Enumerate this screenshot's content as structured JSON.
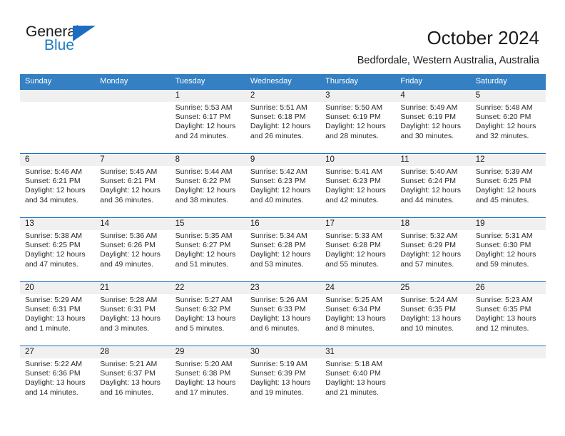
{
  "brand": {
    "word_one": "General",
    "word_two": "Blue",
    "triangle_color": "#1b6ec2",
    "blue_color": "#1f7bc1"
  },
  "header": {
    "title": "October 2024",
    "subtitle": "Bedfordale, Western Australia, Australia"
  },
  "theme": {
    "header_blue": "#3580c3",
    "row_divider_blue": "#1b6ec2",
    "day_band_gray": "#f0f0f0"
  },
  "weekdays": [
    "Sunday",
    "Monday",
    "Tuesday",
    "Wednesday",
    "Thursday",
    "Friday",
    "Saturday"
  ],
  "labels": {
    "sunrise": "Sunrise:",
    "sunset": "Sunset:",
    "daylight": "Daylight:"
  },
  "weeks": [
    [
      {
        "day": "",
        "sunrise": "",
        "sunset": "",
        "daylight_line1": "",
        "daylight_line2": ""
      },
      {
        "day": "",
        "sunrise": "",
        "sunset": "",
        "daylight_line1": "",
        "daylight_line2": ""
      },
      {
        "day": "1",
        "sunrise": "Sunrise: 5:53 AM",
        "sunset": "Sunset: 6:17 PM",
        "daylight_line1": "Daylight: 12 hours",
        "daylight_line2": "and 24 minutes."
      },
      {
        "day": "2",
        "sunrise": "Sunrise: 5:51 AM",
        "sunset": "Sunset: 6:18 PM",
        "daylight_line1": "Daylight: 12 hours",
        "daylight_line2": "and 26 minutes."
      },
      {
        "day": "3",
        "sunrise": "Sunrise: 5:50 AM",
        "sunset": "Sunset: 6:19 PM",
        "daylight_line1": "Daylight: 12 hours",
        "daylight_line2": "and 28 minutes."
      },
      {
        "day": "4",
        "sunrise": "Sunrise: 5:49 AM",
        "sunset": "Sunset: 6:19 PM",
        "daylight_line1": "Daylight: 12 hours",
        "daylight_line2": "and 30 minutes."
      },
      {
        "day": "5",
        "sunrise": "Sunrise: 5:48 AM",
        "sunset": "Sunset: 6:20 PM",
        "daylight_line1": "Daylight: 12 hours",
        "daylight_line2": "and 32 minutes."
      }
    ],
    [
      {
        "day": "6",
        "sunrise": "Sunrise: 5:46 AM",
        "sunset": "Sunset: 6:21 PM",
        "daylight_line1": "Daylight: 12 hours",
        "daylight_line2": "and 34 minutes."
      },
      {
        "day": "7",
        "sunrise": "Sunrise: 5:45 AM",
        "sunset": "Sunset: 6:21 PM",
        "daylight_line1": "Daylight: 12 hours",
        "daylight_line2": "and 36 minutes."
      },
      {
        "day": "8",
        "sunrise": "Sunrise: 5:44 AM",
        "sunset": "Sunset: 6:22 PM",
        "daylight_line1": "Daylight: 12 hours",
        "daylight_line2": "and 38 minutes."
      },
      {
        "day": "9",
        "sunrise": "Sunrise: 5:42 AM",
        "sunset": "Sunset: 6:23 PM",
        "daylight_line1": "Daylight: 12 hours",
        "daylight_line2": "and 40 minutes."
      },
      {
        "day": "10",
        "sunrise": "Sunrise: 5:41 AM",
        "sunset": "Sunset: 6:23 PM",
        "daylight_line1": "Daylight: 12 hours",
        "daylight_line2": "and 42 minutes."
      },
      {
        "day": "11",
        "sunrise": "Sunrise: 5:40 AM",
        "sunset": "Sunset: 6:24 PM",
        "daylight_line1": "Daylight: 12 hours",
        "daylight_line2": "and 44 minutes."
      },
      {
        "day": "12",
        "sunrise": "Sunrise: 5:39 AM",
        "sunset": "Sunset: 6:25 PM",
        "daylight_line1": "Daylight: 12 hours",
        "daylight_line2": "and 45 minutes."
      }
    ],
    [
      {
        "day": "13",
        "sunrise": "Sunrise: 5:38 AM",
        "sunset": "Sunset: 6:25 PM",
        "daylight_line1": "Daylight: 12 hours",
        "daylight_line2": "and 47 minutes."
      },
      {
        "day": "14",
        "sunrise": "Sunrise: 5:36 AM",
        "sunset": "Sunset: 6:26 PM",
        "daylight_line1": "Daylight: 12 hours",
        "daylight_line2": "and 49 minutes."
      },
      {
        "day": "15",
        "sunrise": "Sunrise: 5:35 AM",
        "sunset": "Sunset: 6:27 PM",
        "daylight_line1": "Daylight: 12 hours",
        "daylight_line2": "and 51 minutes."
      },
      {
        "day": "16",
        "sunrise": "Sunrise: 5:34 AM",
        "sunset": "Sunset: 6:28 PM",
        "daylight_line1": "Daylight: 12 hours",
        "daylight_line2": "and 53 minutes."
      },
      {
        "day": "17",
        "sunrise": "Sunrise: 5:33 AM",
        "sunset": "Sunset: 6:28 PM",
        "daylight_line1": "Daylight: 12 hours",
        "daylight_line2": "and 55 minutes."
      },
      {
        "day": "18",
        "sunrise": "Sunrise: 5:32 AM",
        "sunset": "Sunset: 6:29 PM",
        "daylight_line1": "Daylight: 12 hours",
        "daylight_line2": "and 57 minutes."
      },
      {
        "day": "19",
        "sunrise": "Sunrise: 5:31 AM",
        "sunset": "Sunset: 6:30 PM",
        "daylight_line1": "Daylight: 12 hours",
        "daylight_line2": "and 59 minutes."
      }
    ],
    [
      {
        "day": "20",
        "sunrise": "Sunrise: 5:29 AM",
        "sunset": "Sunset: 6:31 PM",
        "daylight_line1": "Daylight: 13 hours",
        "daylight_line2": "and 1 minute."
      },
      {
        "day": "21",
        "sunrise": "Sunrise: 5:28 AM",
        "sunset": "Sunset: 6:31 PM",
        "daylight_line1": "Daylight: 13 hours",
        "daylight_line2": "and 3 minutes."
      },
      {
        "day": "22",
        "sunrise": "Sunrise: 5:27 AM",
        "sunset": "Sunset: 6:32 PM",
        "daylight_line1": "Daylight: 13 hours",
        "daylight_line2": "and 5 minutes."
      },
      {
        "day": "23",
        "sunrise": "Sunrise: 5:26 AM",
        "sunset": "Sunset: 6:33 PM",
        "daylight_line1": "Daylight: 13 hours",
        "daylight_line2": "and 6 minutes."
      },
      {
        "day": "24",
        "sunrise": "Sunrise: 5:25 AM",
        "sunset": "Sunset: 6:34 PM",
        "daylight_line1": "Daylight: 13 hours",
        "daylight_line2": "and 8 minutes."
      },
      {
        "day": "25",
        "sunrise": "Sunrise: 5:24 AM",
        "sunset": "Sunset: 6:35 PM",
        "daylight_line1": "Daylight: 13 hours",
        "daylight_line2": "and 10 minutes."
      },
      {
        "day": "26",
        "sunrise": "Sunrise: 5:23 AM",
        "sunset": "Sunset: 6:35 PM",
        "daylight_line1": "Daylight: 13 hours",
        "daylight_line2": "and 12 minutes."
      }
    ],
    [
      {
        "day": "27",
        "sunrise": "Sunrise: 5:22 AM",
        "sunset": "Sunset: 6:36 PM",
        "daylight_line1": "Daylight: 13 hours",
        "daylight_line2": "and 14 minutes."
      },
      {
        "day": "28",
        "sunrise": "Sunrise: 5:21 AM",
        "sunset": "Sunset: 6:37 PM",
        "daylight_line1": "Daylight: 13 hours",
        "daylight_line2": "and 16 minutes."
      },
      {
        "day": "29",
        "sunrise": "Sunrise: 5:20 AM",
        "sunset": "Sunset: 6:38 PM",
        "daylight_line1": "Daylight: 13 hours",
        "daylight_line2": "and 17 minutes."
      },
      {
        "day": "30",
        "sunrise": "Sunrise: 5:19 AM",
        "sunset": "Sunset: 6:39 PM",
        "daylight_line1": "Daylight: 13 hours",
        "daylight_line2": "and 19 minutes."
      },
      {
        "day": "31",
        "sunrise": "Sunrise: 5:18 AM",
        "sunset": "Sunset: 6:40 PM",
        "daylight_line1": "Daylight: 13 hours",
        "daylight_line2": "and 21 minutes."
      },
      {
        "day": "",
        "sunrise": "",
        "sunset": "",
        "daylight_line1": "",
        "daylight_line2": ""
      },
      {
        "day": "",
        "sunrise": "",
        "sunset": "",
        "daylight_line1": "",
        "daylight_line2": ""
      }
    ]
  ]
}
